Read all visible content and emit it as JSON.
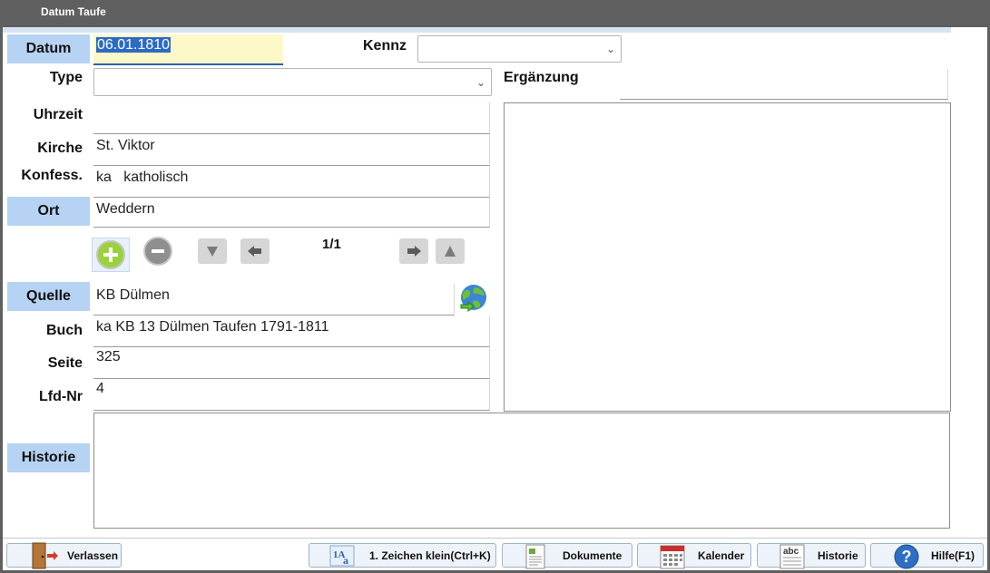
{
  "window": {
    "title": "Datum Taufe"
  },
  "form": {
    "datum": {
      "label": "Datum",
      "value": "06.01.1810"
    },
    "kennz": {
      "label": "Kennz",
      "value": ""
    },
    "type": {
      "label": "Type",
      "value": ""
    },
    "ergaenzung": {
      "label": "Ergänzung",
      "value": ""
    },
    "uhrzeit": {
      "label": "Uhrzeit",
      "value": ""
    },
    "kirche": {
      "label": "Kirche",
      "value": "St. Viktor"
    },
    "konfess": {
      "label": "Konfess.",
      "value": "ka   katholisch"
    },
    "ort": {
      "label": "Ort",
      "value": "Weddern"
    },
    "quelle": {
      "label": "Quelle",
      "value": "KB Dülmen"
    },
    "buch": {
      "label": "Buch",
      "value": "ka KB 13 Dülmen Taufen 1791-1811"
    },
    "seite": {
      "label": "Seite",
      "value": "325"
    },
    "lfdnr": {
      "label": "Lfd-Nr",
      "value": "4"
    },
    "historie": {
      "label": "Historie",
      "value": ""
    }
  },
  "navigator": {
    "counter": "1/1"
  },
  "bottom_buttons": {
    "exit": "Verlassen",
    "lowercase": "1. Zeichen klein(Ctrl+K)",
    "documents": "Dokumente",
    "calendar": "Kalender",
    "history": "Historie",
    "help": "Hilfe(F1)"
  },
  "colors": {
    "label_box": "#b7d3f3",
    "date_field": "#fdf8c8",
    "selection": "#2c6bc4"
  }
}
